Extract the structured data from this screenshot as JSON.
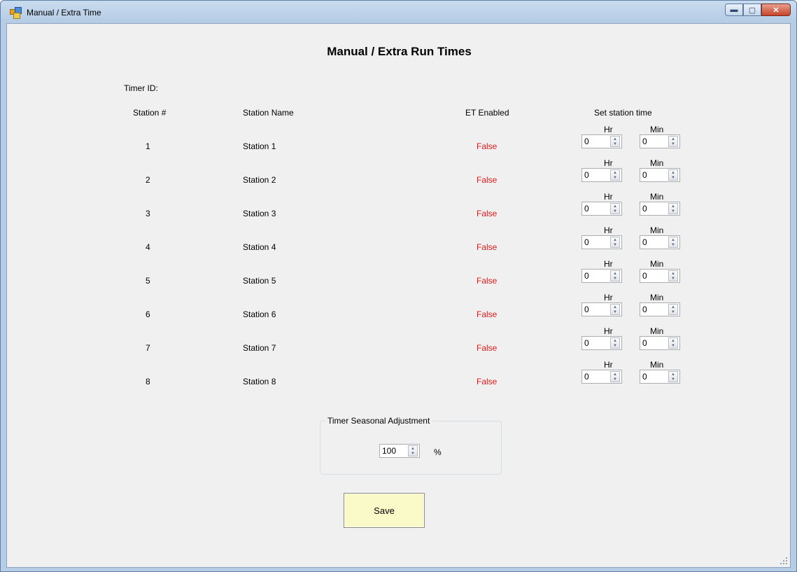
{
  "window": {
    "title": "Manual / Extra Time"
  },
  "form": {
    "heading": "Manual / Extra Run Times",
    "timer_id_label": "Timer ID:",
    "columns": {
      "station_num": "Station #",
      "station_name": "Station Name",
      "et_enabled": "ET Enabled",
      "set_time": "Set station time"
    },
    "hr_label": "Hr",
    "min_label": "Min",
    "stations": [
      {
        "num": "1",
        "name": "Station 1",
        "et": "False",
        "hr": "0",
        "min": "0"
      },
      {
        "num": "2",
        "name": "Station 2",
        "et": "False",
        "hr": "0",
        "min": "0"
      },
      {
        "num": "3",
        "name": "Station 3",
        "et": "False",
        "hr": "0",
        "min": "0"
      },
      {
        "num": "4",
        "name": "Station 4",
        "et": "False",
        "hr": "0",
        "min": "0"
      },
      {
        "num": "5",
        "name": "Station 5",
        "et": "False",
        "hr": "0",
        "min": "0"
      },
      {
        "num": "6",
        "name": "Station 6",
        "et": "False",
        "hr": "0",
        "min": "0"
      },
      {
        "num": "7",
        "name": "Station 7",
        "et": "False",
        "hr": "0",
        "min": "0"
      },
      {
        "num": "8",
        "name": "Station 8",
        "et": "False",
        "hr": "0",
        "min": "0"
      }
    ],
    "seasonal": {
      "title": "Timer Seasonal Adjustment",
      "value": "100",
      "unit": "%"
    },
    "save_label": "Save"
  },
  "colors": {
    "false_text": "#e01818",
    "save_bg": "#fafac8"
  }
}
